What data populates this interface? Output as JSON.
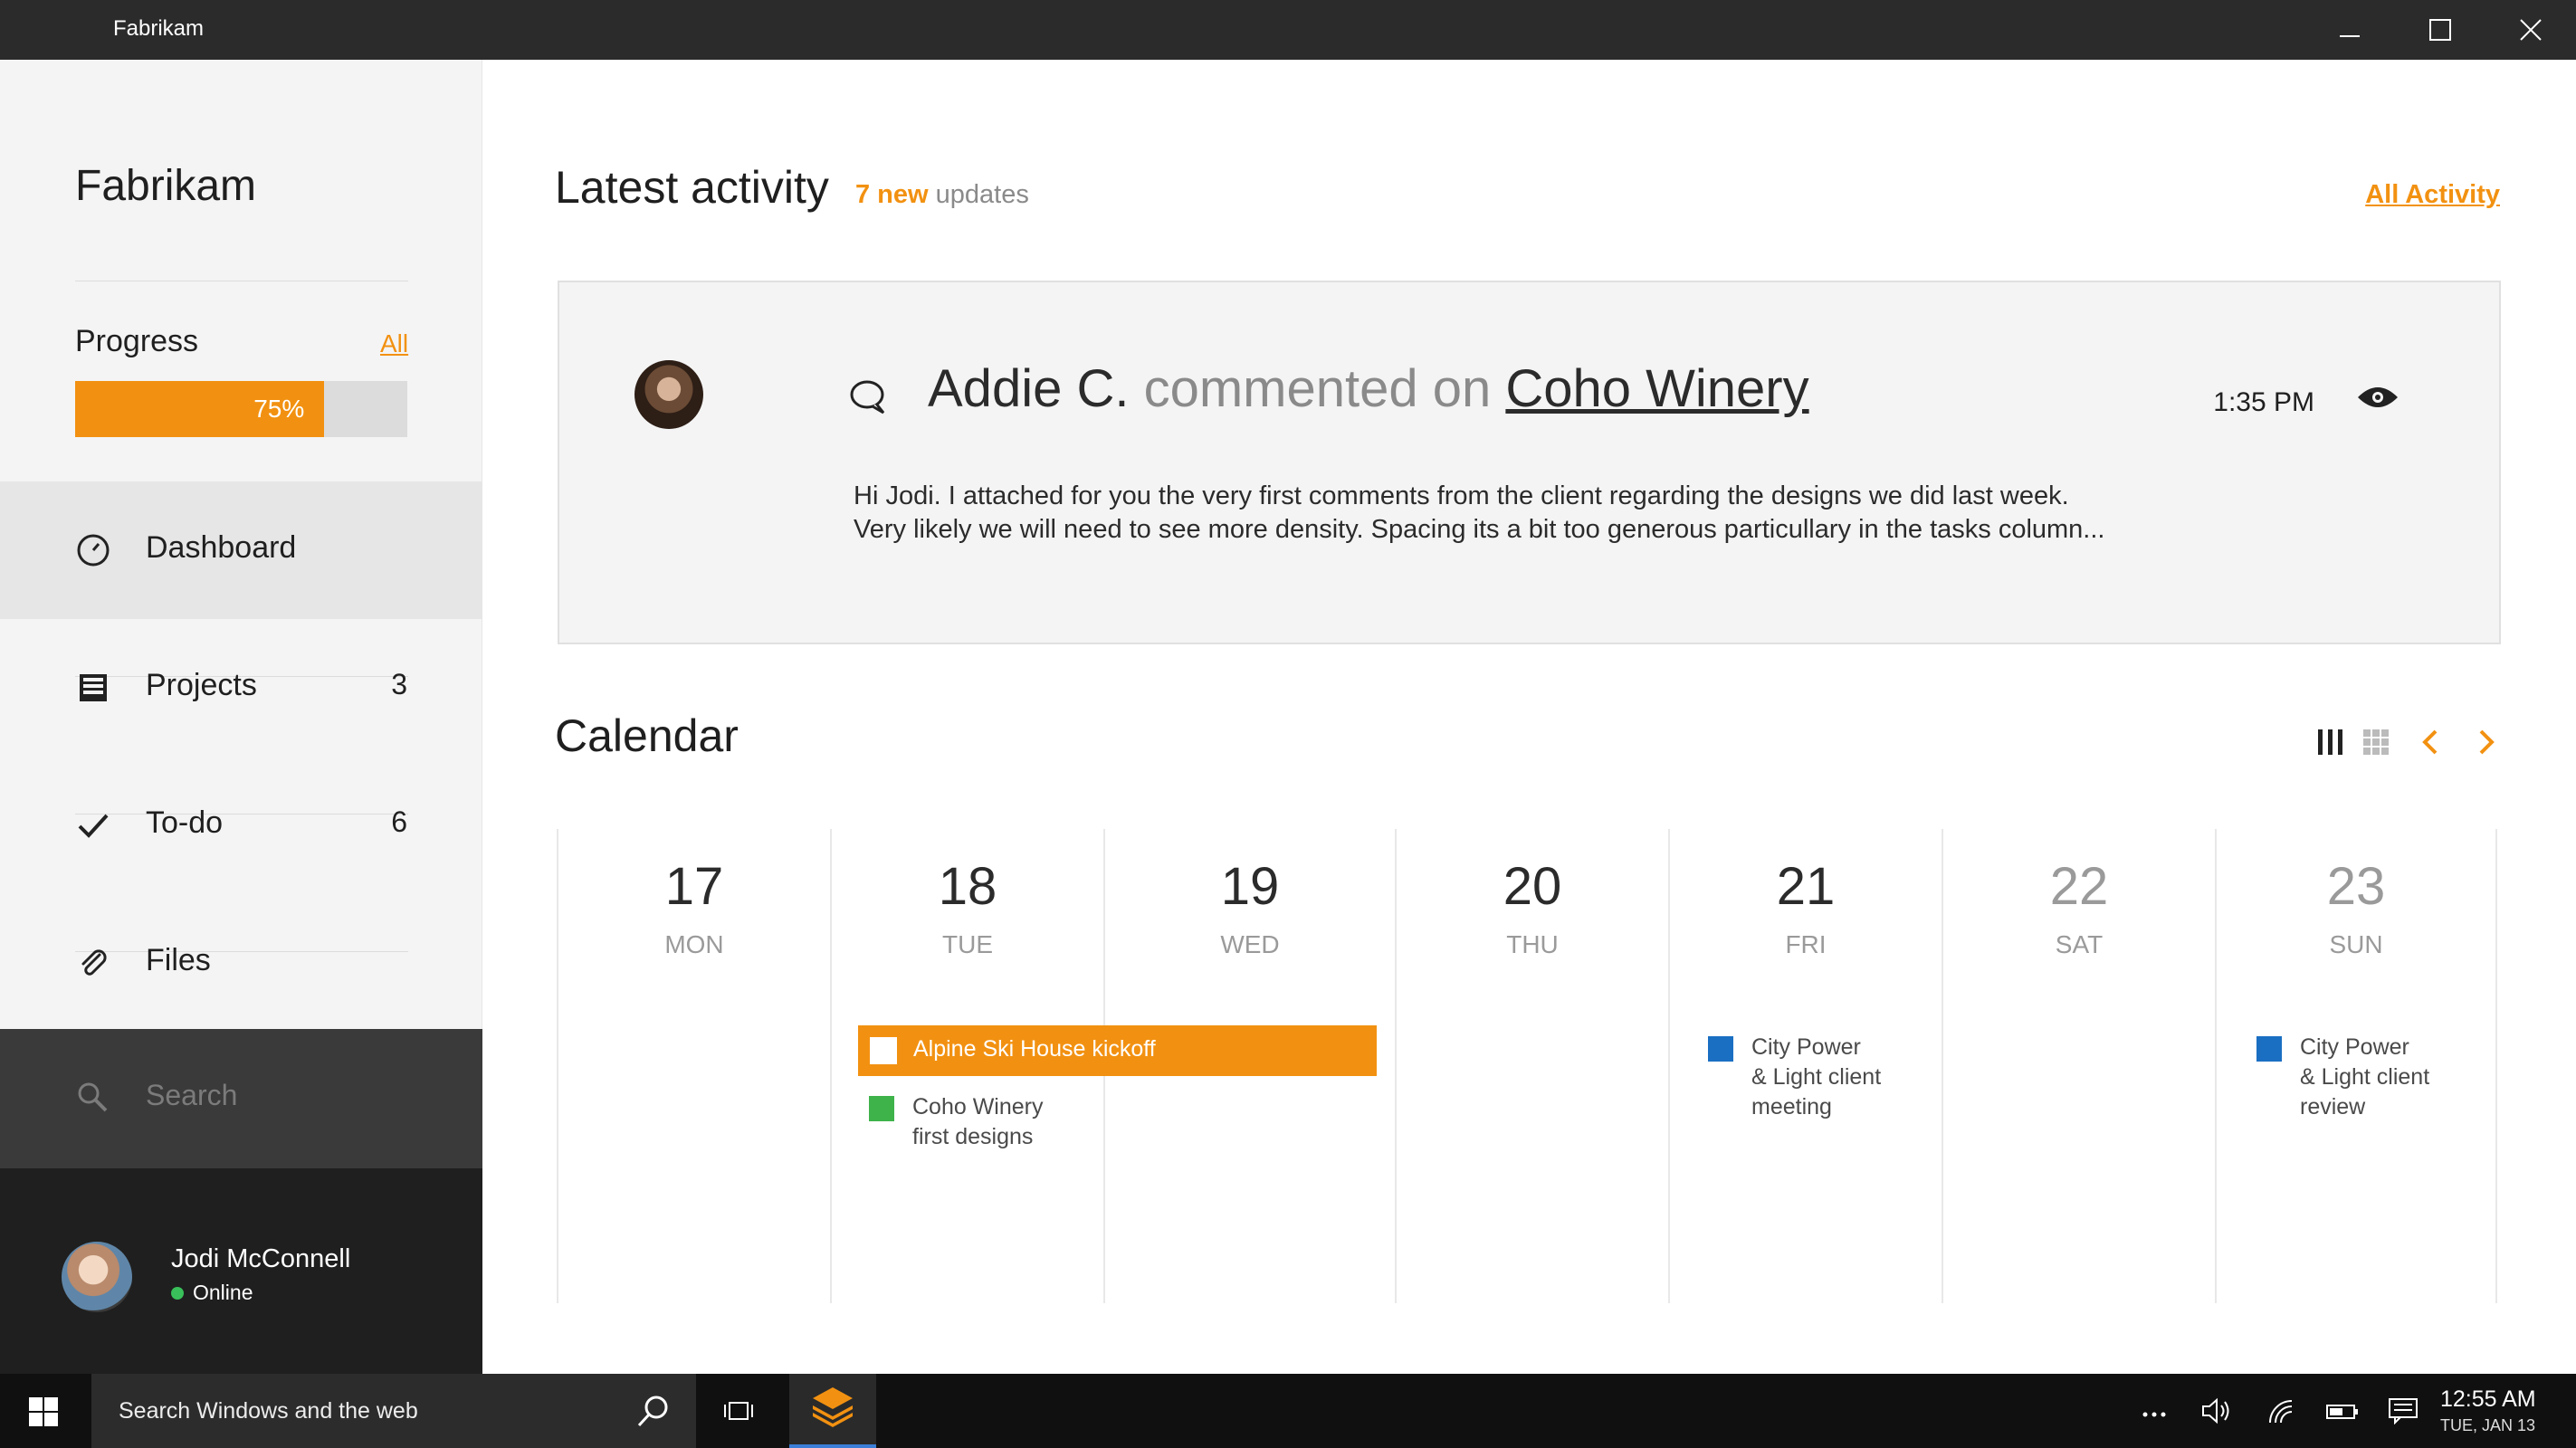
{
  "window": {
    "title": "Fabrikam"
  },
  "sidebar": {
    "brand": "Fabrikam",
    "progress": {
      "label": "Progress",
      "all_link": "All",
      "value_text": "75%",
      "value": 75
    },
    "nav": [
      {
        "label": "Dashboard",
        "count": "",
        "icon": "dashboard-icon",
        "active": true
      },
      {
        "label": "Projects",
        "count": "3",
        "icon": "projects-icon",
        "active": false
      },
      {
        "label": "To-do",
        "count": "6",
        "icon": "checkmark-icon",
        "active": false
      },
      {
        "label": "Files",
        "count": "",
        "icon": "paperclip-icon",
        "active": false
      }
    ],
    "search_placeholder": "Search",
    "user": {
      "name": "Jodi McConnell",
      "status": "Online",
      "status_color": "#39c05a"
    }
  },
  "main": {
    "latest": {
      "title": "Latest activity",
      "new_count": "7 new",
      "updates_suffix": "updates",
      "all_activity": "All Activity"
    },
    "activity": {
      "author": "Addie C.",
      "verb": "commented on",
      "target": "Coho Winery",
      "time": "1:35 PM",
      "body_line1": "Hi Jodi. I attached for you the very first comments from the client regarding the designs we did last week.",
      "body_line2": "Very likely we will need to see more density. Spacing its a bit too generous particullary in the tasks column..."
    },
    "calendar": {
      "title": "Calendar",
      "days": [
        {
          "num": "17",
          "name": "MON",
          "weekend": false
        },
        {
          "num": "18",
          "name": "TUE",
          "weekend": false
        },
        {
          "num": "19",
          "name": "WED",
          "weekend": false
        },
        {
          "num": "20",
          "name": "THU",
          "weekend": false
        },
        {
          "num": "21",
          "name": "FRI",
          "weekend": false
        },
        {
          "num": "22",
          "name": "SAT",
          "weekend": true
        },
        {
          "num": "23",
          "name": "SUN",
          "weekend": true
        }
      ],
      "events": {
        "alpine": {
          "label": "Alpine Ski House kickoff",
          "color": "#f29111"
        },
        "coho_line1": "Coho Winery",
        "coho_line2": "first designs",
        "coho_color": "#3db34a",
        "city_meeting": [
          "City Power",
          "& Light client",
          "meeting"
        ],
        "city_review": [
          "City Power",
          "& Light client",
          "review"
        ],
        "city_color": "#1a6fc3"
      }
    }
  },
  "taskbar": {
    "search_text": "Search Windows and the web",
    "time": "12:55 AM",
    "date": "TUE, JAN 13"
  },
  "colors": {
    "accent": "#f29111",
    "titlebar": "#2b2b2b",
    "taskbar": "#101010"
  }
}
